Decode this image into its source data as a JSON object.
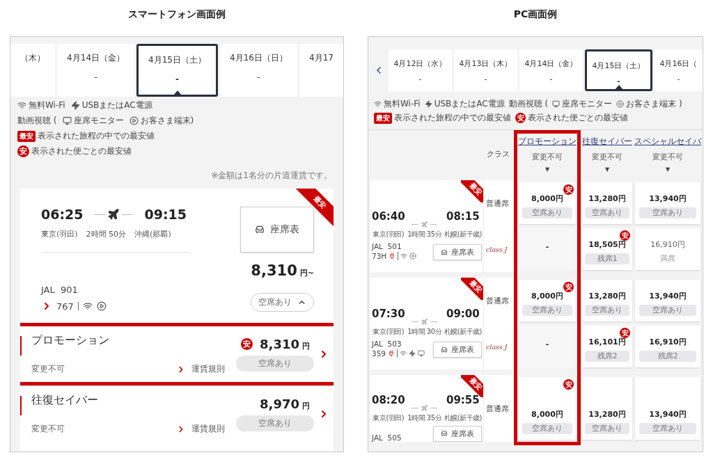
{
  "phone": {
    "heading": "スマートフォン画面例",
    "dates": [
      {
        "label": "（木）",
        "selected": false
      },
      {
        "label": "4月14日（金）",
        "value": "-",
        "selected": false
      },
      {
        "label": "4月15日（土）",
        "value": "-",
        "selected": true
      },
      {
        "label": "4月16日（日）",
        "value": "-",
        "selected": false
      },
      {
        "label": "4月17",
        "selected": false
      }
    ],
    "legend": [
      [
        {
          "kind": "wifi",
          "text": "無料Wi-Fi"
        },
        {
          "kind": "power",
          "text": "USBまたはAC電源"
        }
      ],
      [
        {
          "kind": "plain",
          "text": "動画視聴 ("
        },
        {
          "kind": "monitor",
          "text": "座席モニター"
        },
        {
          "kind": "video",
          "text": "お客さま端末)"
        }
      ],
      [
        {
          "kind": "tag",
          "tag": "最安",
          "text": "表示された旅程の中での最安値"
        }
      ],
      [
        {
          "kind": "badge",
          "badge": "安",
          "text": "表示された便ごとの最安値"
        }
      ]
    ],
    "note": "※金額は1名分の片道運賃です。",
    "flight": {
      "ribbon": "最安",
      "dep_time": "06:25",
      "dep_airport": "東京(羽田)",
      "duration": "2時間 50分",
      "arr_time": "09:15",
      "arr_airport": "沖縄(那覇)",
      "seat_button": "座席表",
      "price": "8,310",
      "price_unit": "円~",
      "flight_no": "JAL  901",
      "aircraft": "767",
      "amenities": [
        {
          "kind": "wifi"
        },
        {
          "kind": "video"
        }
      ],
      "availability": "空席あり",
      "expanded": true,
      "fares": [
        {
          "name": "プロモーション",
          "condition": "変更不可",
          "rules_link": "運賃規則",
          "badge": "安",
          "price": "8,310",
          "unit": "円",
          "availability": "空席あり",
          "highlighted": true
        },
        {
          "name": "往復セイバー",
          "condition": "変更不可",
          "rules_link": "運賃規則",
          "price": "8,970",
          "unit": "円",
          "availability": "空席あり",
          "highlighted": false
        }
      ]
    }
  },
  "pc": {
    "heading": "PC画面例",
    "dates": [
      {
        "label": "4月12日（水）",
        "value": "-",
        "selected": false
      },
      {
        "label": "4月13日（木）",
        "value": "-",
        "selected": false
      },
      {
        "label": "4月14日（金）",
        "value": "-",
        "selected": false
      },
      {
        "label": "4月15日（土）",
        "value": "-",
        "selected": true
      },
      {
        "label": "4月16日（",
        "value": "-",
        "selected": false
      }
    ],
    "legend": [
      [
        {
          "kind": "wifi",
          "text": "無料Wi-Fi"
        },
        {
          "kind": "power",
          "text": "USBまたはAC電源"
        },
        {
          "kind": "plain",
          "text": "動画視聴 ("
        },
        {
          "kind": "monitor",
          "text": "座席モニター"
        },
        {
          "kind": "video",
          "text": "お客さま端末 )"
        }
      ],
      [
        {
          "kind": "tag",
          "tag": "最安",
          "text": "表示された旅程の中での最安値"
        },
        {
          "kind": "badge",
          "badge": "安",
          "text": "表示された便ごとの最安値"
        }
      ]
    ],
    "class_label": "クラス",
    "columns": [
      {
        "name": "プロモーション",
        "condition": "変更不可",
        "sort": "▼",
        "highlighted": true
      },
      {
        "name": "往復セイバー",
        "condition": "変更不可",
        "sort": "▼",
        "highlighted": false
      },
      {
        "name": "スペシャルセイバ",
        "condition": "変更不可",
        "sort": "▼",
        "highlighted": false
      }
    ],
    "flights": [
      {
        "ribbon": "最安",
        "dep_time": "06:40",
        "dep_airport": "東京(羽田)",
        "duration": "1時間 35分",
        "arr_time": "08:15",
        "arr_airport": "札幌(新千歳)",
        "flight_no": "JAL  501",
        "aircraft": "73H",
        "amenities": [
          {
            "kind": "outlet"
          },
          {
            "kind": "wifi"
          },
          {
            "kind": "video"
          }
        ],
        "seat_button": "座席表",
        "classes": [
          {
            "kind": "standard",
            "name": "普通席",
            "fares": [
              {
                "price": "8,000円",
                "badge": "安",
                "availability": "空席あり",
                "kind": "available"
              },
              {
                "price": "13,280円",
                "availability": "空席あり",
                "kind": "available"
              },
              {
                "price": "13,940円",
                "availability": "空席あり",
                "kind": "available"
              }
            ]
          },
          {
            "kind": "premium",
            "name": "class J",
            "fares": [
              {
                "price": "-",
                "kind": "empty"
              },
              {
                "price": "18,505円",
                "badge": "安",
                "availability": "残席1",
                "kind": "available"
              },
              {
                "price": "16,910円",
                "availability": "満席",
                "kind": "soldout"
              }
            ]
          }
        ]
      },
      {
        "ribbon": "最安",
        "dep_time": "07:30",
        "dep_airport": "東京(羽田)",
        "duration": "1時間 30分",
        "arr_time": "09:00",
        "arr_airport": "札幌(新千歳)",
        "flight_no": "JAL  503",
        "aircraft": "359",
        "amenities": [
          {
            "kind": "outlet"
          },
          {
            "kind": "wifi"
          },
          {
            "kind": "power"
          },
          {
            "kind": "monitor"
          }
        ],
        "seat_button": "座席表",
        "classes": [
          {
            "kind": "standard",
            "name": "普通席",
            "fares": [
              {
                "price": "8,000円",
                "badge": "安",
                "availability": "空席あり",
                "kind": "available"
              },
              {
                "price": "13,280円",
                "availability": "空席あり",
                "kind": "available"
              },
              {
                "price": "13,940円",
                "availability": "空席あり",
                "kind": "available"
              }
            ]
          },
          {
            "kind": "premium",
            "name": "class J",
            "fares": [
              {
                "price": "-",
                "kind": "empty"
              },
              {
                "price": "16,101円",
                "badge": "安",
                "availability": "残席2",
                "kind": "available"
              },
              {
                "price": "16,910円",
                "availability": "残席2",
                "kind": "available"
              }
            ]
          }
        ]
      },
      {
        "ribbon": "最安",
        "dep_time": "08:20",
        "dep_airport": "東京(羽田)",
        "duration": "1時間 35分",
        "arr_time": "09:55",
        "arr_airport": "札幌(新千歳)",
        "flight_no": "JAL  505",
        "seat_button": "座席表",
        "classes": [
          {
            "kind": "standard",
            "name": "普通席",
            "fares": [
              {
                "price": "8,000円",
                "badge": "安",
                "availability": "空席あり",
                "kind": "available"
              },
              {
                "price": "13,280円",
                "availability": "空席あり",
                "kind": "available"
              },
              {
                "price": "13,940円",
                "availability": "空席あり",
                "kind": "available"
              }
            ]
          }
        ]
      }
    ]
  }
}
